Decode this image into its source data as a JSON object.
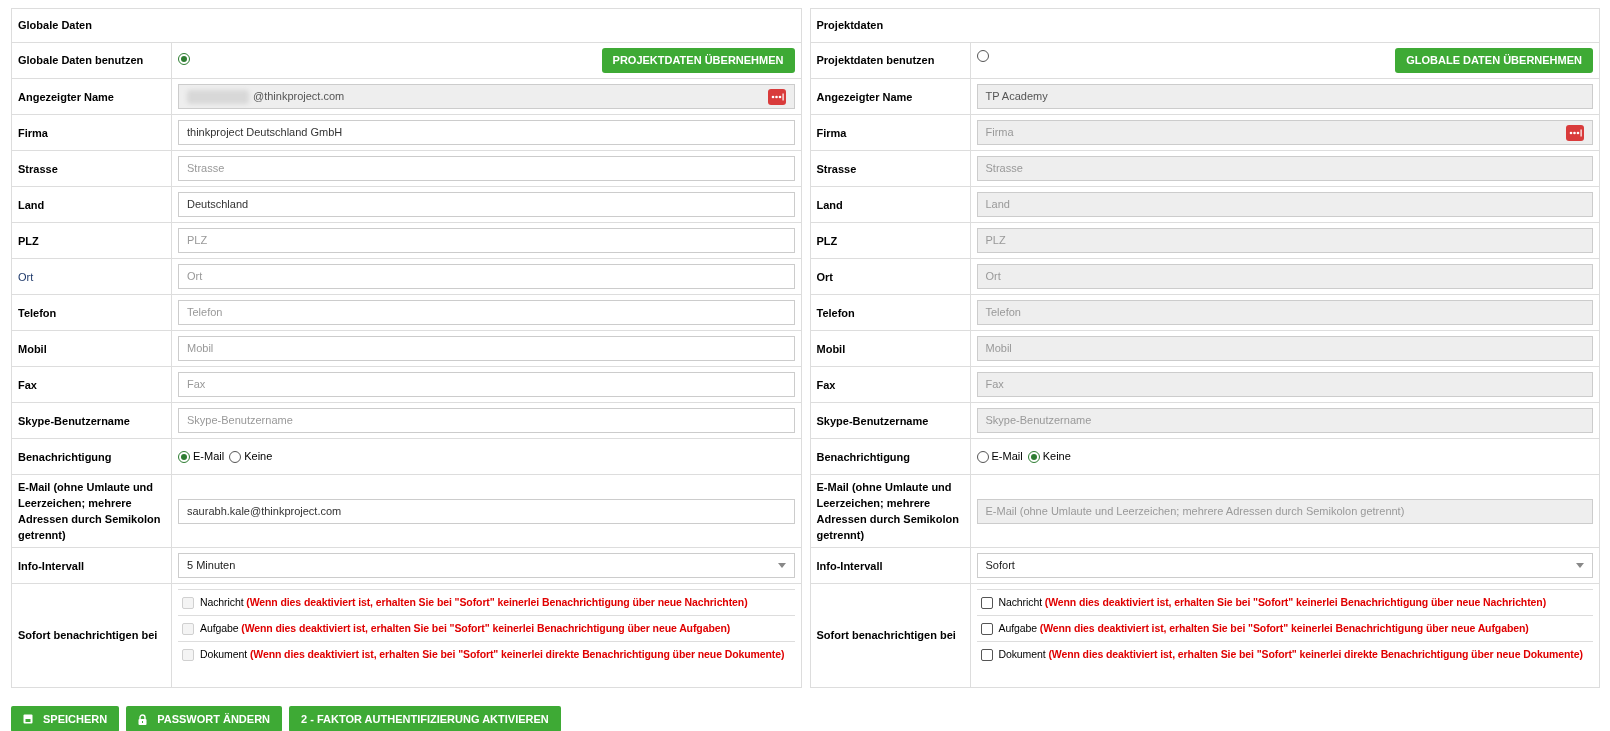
{
  "panels": [
    {
      "title": "Globale Daten",
      "use": {
        "label": "Globale Daten benutzen",
        "selected": true,
        "button": "PROJEKTDATEN ÜBERNEHMEN"
      },
      "fields": [
        {
          "label": "Angezeigter Name",
          "bold": true,
          "value": "@thinkproject.com",
          "redacted": true,
          "disabled": true,
          "menu_icon": true
        },
        {
          "label": "Firma",
          "bold": true,
          "value": "thinkproject Deutschland GmbH",
          "disabled": false,
          "menu_icon": false
        },
        {
          "label": "Strasse",
          "bold": true,
          "placeholder": "Strasse",
          "disabled": false,
          "menu_icon": false
        },
        {
          "label": "Land",
          "bold": true,
          "value": "Deutschland",
          "disabled": false,
          "menu_icon": false
        },
        {
          "label": "PLZ",
          "bold": true,
          "placeholder": "PLZ",
          "disabled": false,
          "menu_icon": false
        },
        {
          "label": "Ort",
          "bold": false,
          "placeholder": "Ort",
          "disabled": false,
          "menu_icon": false
        },
        {
          "label": "Telefon",
          "bold": true,
          "placeholder": "Telefon",
          "disabled": false,
          "menu_icon": false
        },
        {
          "label": "Mobil",
          "bold": true,
          "placeholder": "Mobil",
          "disabled": false,
          "menu_icon": false
        },
        {
          "label": "Fax",
          "bold": true,
          "placeholder": "Fax",
          "disabled": false,
          "menu_icon": false
        },
        {
          "label": "Skype-Benutzername",
          "bold": true,
          "placeholder": "Skype-Benutzername",
          "disabled": false,
          "menu_icon": false
        }
      ],
      "notification": {
        "label": "Benachrichtigung",
        "options": [
          {
            "label": "E-Mail",
            "selected": true
          },
          {
            "label": "Keine",
            "selected": false
          }
        ]
      },
      "email": {
        "label": "E-Mail (ohne Umlaute und Leerzeichen; mehrere Adressen durch Semikolon getrennt)",
        "value": "saurabh.kale@thinkproject.com",
        "disabled": false
      },
      "interval": {
        "label": "Info-Intervall",
        "value": "5 Minuten"
      },
      "instant": {
        "label": "Sofort benachrichtigen bei",
        "items": [
          {
            "name": "Nachricht",
            "note": "(Wenn dies deaktiviert ist, erhalten Sie bei \"Sofort\" keinerlei Benachrichtigung über neue Nachrichten)",
            "checked": false,
            "disabled": true
          },
          {
            "name": "Aufgabe",
            "note": "(Wenn dies deaktiviert ist, erhalten Sie bei \"Sofort\" keinerlei Benachrichtigung über neue Aufgaben)",
            "checked": false,
            "disabled": true
          },
          {
            "name": "Dokument",
            "note": "(Wenn dies deaktiviert ist, erhalten Sie bei \"Sofort\" keinerlei direkte Benachrichtigung über neue Dokumente)",
            "checked": false,
            "disabled": true
          }
        ]
      }
    },
    {
      "title": "Projektdaten",
      "use": {
        "label": "Projektdaten benutzen",
        "selected": false,
        "button": "GLOBALE DATEN ÜBERNEHMEN"
      },
      "fields": [
        {
          "label": "Angezeigter Name",
          "bold": true,
          "value": "TP Academy",
          "disabled": true,
          "menu_icon": false
        },
        {
          "label": "Firma",
          "bold": true,
          "placeholder": "Firma",
          "disabled": true,
          "menu_icon": true
        },
        {
          "label": "Strasse",
          "bold": true,
          "placeholder": "Strasse",
          "disabled": true,
          "menu_icon": false
        },
        {
          "label": "Land",
          "bold": true,
          "placeholder": "Land",
          "disabled": true,
          "menu_icon": false
        },
        {
          "label": "PLZ",
          "bold": true,
          "placeholder": "PLZ",
          "disabled": true,
          "menu_icon": false
        },
        {
          "label": "Ort",
          "bold": true,
          "placeholder": "Ort",
          "disabled": true,
          "menu_icon": false
        },
        {
          "label": "Telefon",
          "bold": true,
          "placeholder": "Telefon",
          "disabled": true,
          "menu_icon": false
        },
        {
          "label": "Mobil",
          "bold": true,
          "placeholder": "Mobil",
          "disabled": true,
          "menu_icon": false
        },
        {
          "label": "Fax",
          "bold": true,
          "placeholder": "Fax",
          "disabled": true,
          "menu_icon": false
        },
        {
          "label": "Skype-Benutzername",
          "bold": true,
          "placeholder": "Skype-Benutzername",
          "disabled": true,
          "menu_icon": false
        }
      ],
      "notification": {
        "label": "Benachrichtigung",
        "options": [
          {
            "label": "E-Mail",
            "selected": false
          },
          {
            "label": "Keine",
            "selected": true
          }
        ]
      },
      "email": {
        "label": "E-Mail (ohne Umlaute und Leerzeichen; mehrere Adressen durch Semikolon getrennt)",
        "placeholder": "E-Mail (ohne Umlaute und Leerzeichen; mehrere Adressen durch Semikolon getrennt)",
        "disabled": true
      },
      "interval": {
        "label": "Info-Intervall",
        "value": "Sofort"
      },
      "instant": {
        "label": "Sofort benachrichtigen bei",
        "items": [
          {
            "name": "Nachricht",
            "note": "(Wenn dies deaktiviert ist, erhalten Sie bei \"Sofort\" keinerlei Benachrichtigung über neue Nachrichten)",
            "checked": false,
            "disabled": false
          },
          {
            "name": "Aufgabe",
            "note": "(Wenn dies deaktiviert ist, erhalten Sie bei \"Sofort\" keinerlei Benachrichtigung über neue Aufgaben)",
            "checked": false,
            "disabled": false
          },
          {
            "name": "Dokument",
            "note": "(Wenn dies deaktiviert ist, erhalten Sie bei \"Sofort\" keinerlei direkte Benachrichtigung über neue Dokumente)",
            "checked": false,
            "disabled": false
          }
        ]
      }
    }
  ],
  "actions": [
    {
      "kind": "save",
      "label": "SPEICHERN"
    },
    {
      "kind": "lock",
      "label": "PASSWORT ÄNDERN"
    },
    {
      "kind": "none",
      "label": "2 - FAKTOR AUTHENTIFIZIERUNG AKTIVIEREN"
    }
  ]
}
